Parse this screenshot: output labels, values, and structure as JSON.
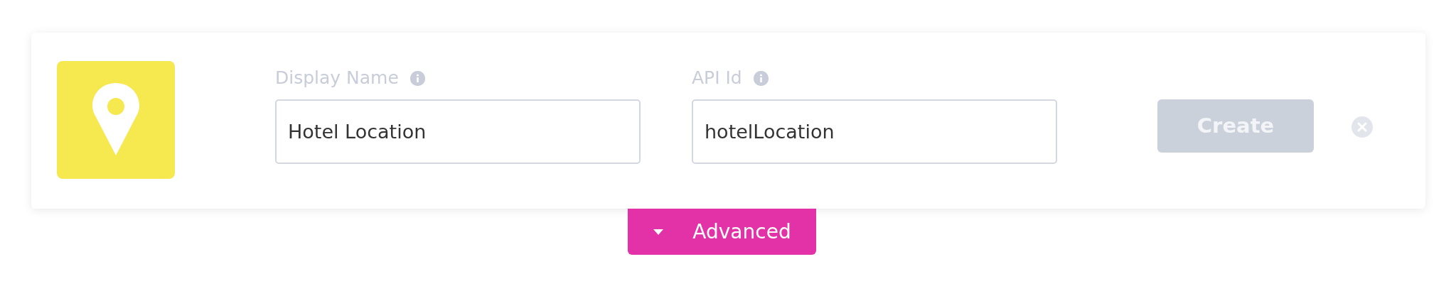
{
  "fields": [
    {
      "label": "Display Name",
      "value": "Hotel Location"
    },
    {
      "label": "API Id",
      "value": "hotelLocation"
    }
  ],
  "create_button": {
    "label": "Create",
    "disabled": true
  },
  "advanced_toggle": {
    "label": "Advanced",
    "expanded": false
  }
}
